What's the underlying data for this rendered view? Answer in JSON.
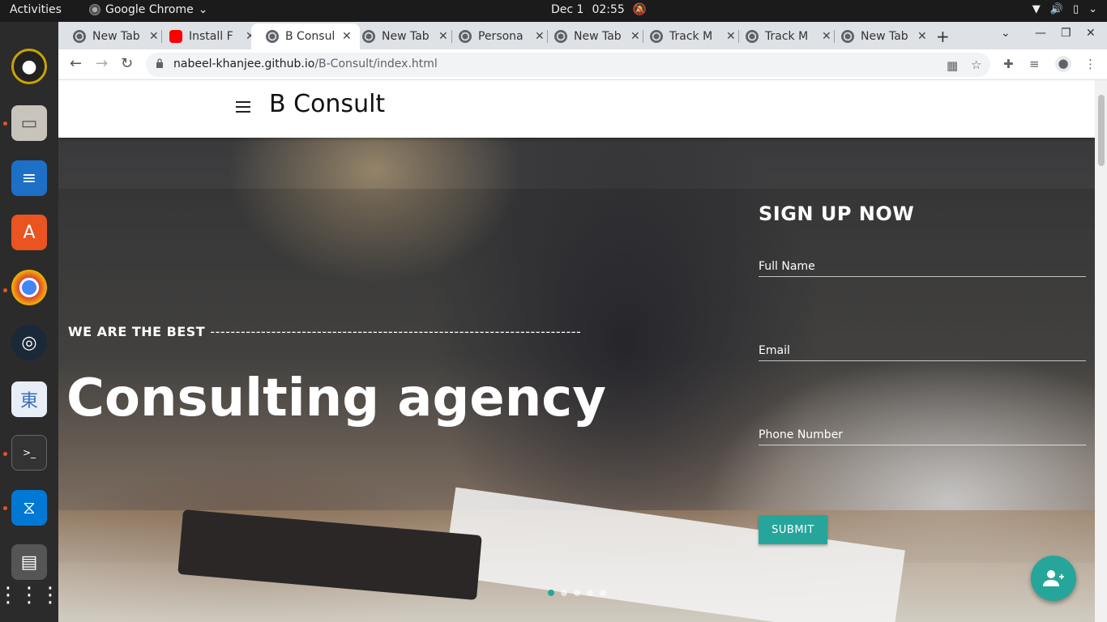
{
  "system": {
    "activities": "Activities",
    "app_name": "Google Chrome",
    "date": "Dec 1",
    "time": "02:55"
  },
  "browser": {
    "tabs": [
      {
        "title": "New Tab",
        "favicon": "chrome-icon"
      },
      {
        "title": "Install F",
        "favicon": "youtube-icon"
      },
      {
        "title": "B Consult",
        "favicon": "chrome-icon",
        "active": true
      },
      {
        "title": "New Tab",
        "favicon": "chrome-icon"
      },
      {
        "title": "Persona",
        "favicon": "chrome-icon"
      },
      {
        "title": "New Tab",
        "favicon": "chrome-icon"
      },
      {
        "title": "Track M",
        "favicon": "chrome-icon"
      },
      {
        "title": "Track M",
        "favicon": "chrome-icon"
      },
      {
        "title": "New Tab",
        "favicon": "chrome-icon"
      }
    ],
    "url_host": "nabeel-khanjee.github.io",
    "url_path": "/B-Consult/index.html"
  },
  "site": {
    "brand": "B Consult",
    "tagline": "WE ARE THE BEST",
    "tagline_dashes": "-------------------------------------------------------------------------",
    "headline": "Consulting agency",
    "form": {
      "title": "SIGN UP NOW",
      "full_name_placeholder": "Full Name",
      "email_placeholder": "Email",
      "phone_placeholder": "Phone Number",
      "submit_label": "SUBMIT"
    },
    "accent_color": "#26a69a"
  }
}
